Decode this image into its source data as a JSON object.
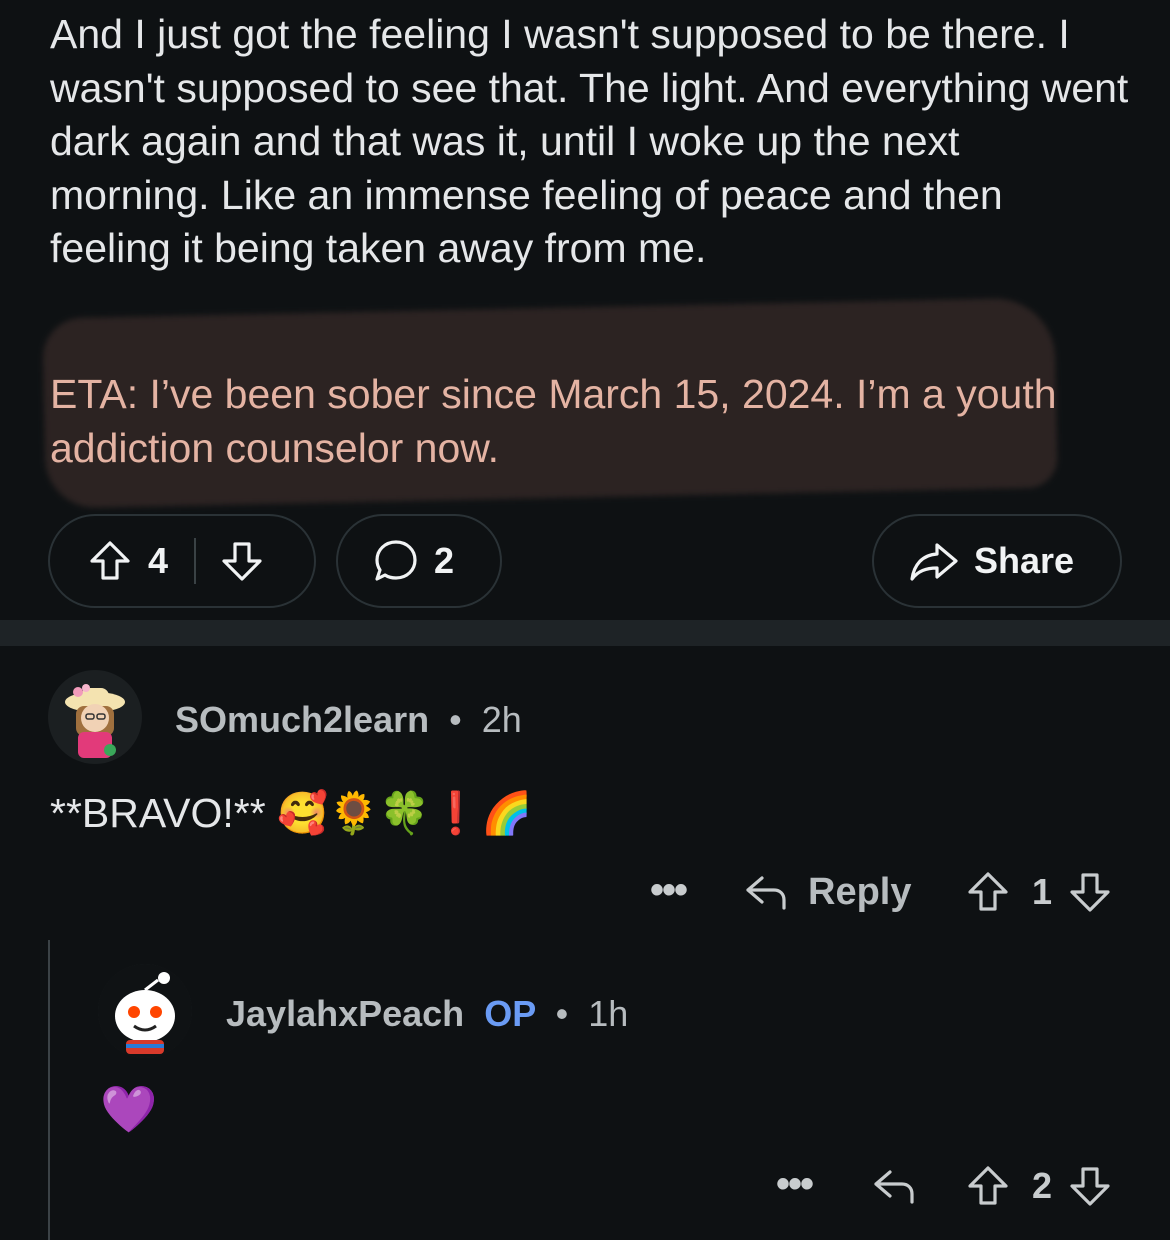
{
  "post": {
    "body": "And I just got the feeling I wasn't supposed to be there. I wasn't supposed to see that. The light. And everything went dark again and that was it, until I woke up the next morning. Like an immense feeling of peace and then feeling it being taken away from me.",
    "eta": "ETA: I’ve been sober since March 15, 2024. I’m a youth addiction counselor now.",
    "vote_count": "4",
    "comment_count": "2",
    "share_label": "Share"
  },
  "comments": [
    {
      "username": "SOmuch2learn",
      "dot": "•",
      "time": "2h",
      "text": "**BRAVO!** 🥰🌻🍀❗️🌈",
      "more": "•••",
      "reply_label": "Reply",
      "votes": "1"
    },
    {
      "username": "JaylahxPeach",
      "op_label": "OP",
      "dot": "•",
      "time": "1h",
      "text": "💜",
      "more": "•••",
      "votes": "2"
    }
  ],
  "icons": {
    "upvote": "arrow-up-outline-icon",
    "downvote": "arrow-down-outline-icon",
    "comment": "speech-bubble-icon",
    "share": "share-arrow-icon",
    "reply": "reply-arrow-icon",
    "more": "ellipsis-icon"
  },
  "colors": {
    "background": "#0e1113",
    "op_accent": "#6a9bf4",
    "eta_text": "#e4b3a3"
  }
}
